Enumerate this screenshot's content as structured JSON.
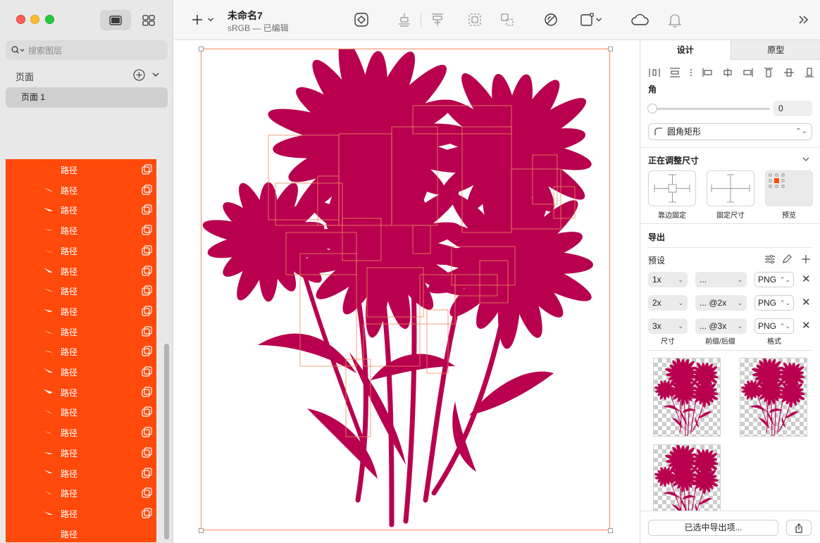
{
  "window": {
    "traffic_lights": [
      "close",
      "minimize",
      "zoom"
    ]
  },
  "sidebar": {
    "search_placeholder": "搜索图层",
    "pages_title": "页面",
    "pages": [
      {
        "label": "页面 1"
      }
    ],
    "layer_panel_color": "#ff4a0b",
    "layers": [
      {
        "label": "路径",
        "icon": "path-icon"
      },
      {
        "label": "路径",
        "icon": "path-icon"
      },
      {
        "label": "路径",
        "icon": "path-icon"
      },
      {
        "label": "路径",
        "icon": "path-icon"
      },
      {
        "label": "路径",
        "icon": "path-icon"
      },
      {
        "label": "路径",
        "icon": "path-icon"
      },
      {
        "label": "路径",
        "icon": "path-icon"
      },
      {
        "label": "路径",
        "icon": "path-icon"
      },
      {
        "label": "路径",
        "icon": "path-icon"
      },
      {
        "label": "路径",
        "icon": "path-icon"
      },
      {
        "label": "路径",
        "icon": "path-icon"
      },
      {
        "label": "路径",
        "icon": "path-icon"
      },
      {
        "label": "路径",
        "icon": "path-icon"
      },
      {
        "label": "路径",
        "icon": "path-icon"
      },
      {
        "label": "路径",
        "icon": "path-icon"
      },
      {
        "label": "路径",
        "icon": "path-icon"
      },
      {
        "label": "路径",
        "icon": "path-icon"
      },
      {
        "label": "路径",
        "icon": "path-icon"
      },
      {
        "label": "路径",
        "icon": "path-icon"
      }
    ]
  },
  "toolbar": {
    "doc_title": "未命名7",
    "doc_subtitle": "sRGB — 已编辑",
    "icons": [
      "insert-icon",
      "symbol-icon",
      "align-bottom-icon",
      "distribute-icon",
      "group-icon",
      "ungroup-icon",
      "mask-icon",
      "frame-icon",
      "cloud-icon",
      "notification-icon",
      "more-icon"
    ]
  },
  "canvas": {
    "artwork_color": "#b8004f",
    "selection_color": "#f08a5d"
  },
  "inspector": {
    "tabs": [
      "设计",
      "原型"
    ],
    "corner_label": "角",
    "corner_value": "0",
    "corner_style": "圆角矩形",
    "resizing_title": "正在调整尺寸",
    "resize_options": [
      "靠边固定",
      "固定尺寸",
      "预览"
    ],
    "export_title": "导出",
    "presets_label": "预设",
    "export_rows": [
      {
        "scale": "1x",
        "suffix": "...",
        "format": "PNG"
      },
      {
        "scale": "2x",
        "suffix": "... @2x",
        "format": "PNG"
      },
      {
        "scale": "3x",
        "suffix": "... @3x",
        "format": "PNG"
      }
    ],
    "column_labels": [
      "尺寸",
      "前缀/后缀",
      "格式"
    ],
    "export_button": "已选中导出项..."
  }
}
